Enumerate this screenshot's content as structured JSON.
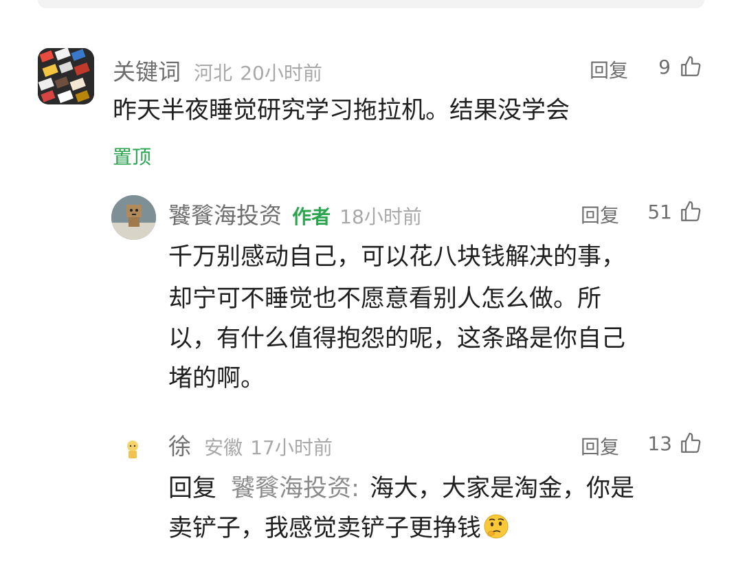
{
  "comments": [
    {
      "username": "关键词",
      "location": "河北",
      "time": "20小时前",
      "reply_label": "回复",
      "likes": "9",
      "text": "昨天半夜睡觉研究学习拖拉机。结果没学会",
      "pinned_label": "置顶"
    },
    {
      "username": "饕餮海投资",
      "author_tag": "作者",
      "time": "18小时前",
      "reply_label": "回复",
      "likes": "51",
      "lines": [
        "千万别感动自己，可以花八块钱解决的事，",
        "却宁可不睡觉也不愿意看别人怎么做。所",
        "以，有什么值得抱怨的呢，这条路是你自己",
        "堵的啊。"
      ]
    },
    {
      "username": "徐",
      "location": "安徽",
      "time": "17小时前",
      "reply_label": "回复",
      "likes": "13",
      "reply_prefix": "回复",
      "mention": "饕餮海投资:",
      "line1_rest": "海大，大家是淘金，你是",
      "line2": "卖铲子，我感觉卖铲子更挣钱",
      "emoji": "thinking-face"
    }
  ]
}
